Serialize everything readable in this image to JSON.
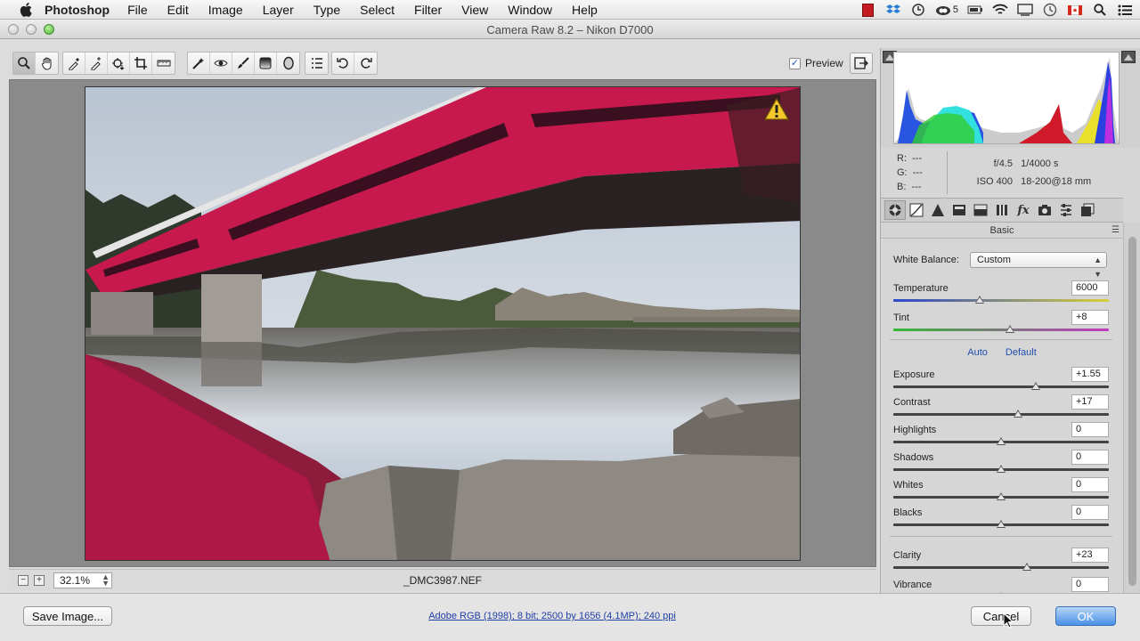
{
  "menubar": {
    "app_name": "Photoshop",
    "items": [
      "File",
      "Edit",
      "Image",
      "Layer",
      "Type",
      "Select",
      "Filter",
      "View",
      "Window",
      "Help"
    ],
    "status_badge": "5"
  },
  "window": {
    "title": "Camera Raw 8.2  –  Nikon D7000"
  },
  "toolbar": {
    "tools": [
      "zoom-tool",
      "hand-tool",
      "white-balance-tool",
      "color-sampler-tool",
      "targeted-adjustment-tool",
      "crop-tool",
      "straighten-tool",
      "spot-removal-tool",
      "red-eye-removal-tool",
      "adjustment-brush-tool",
      "graduated-filter-tool",
      "radial-filter-tool",
      "preferences",
      "rotate-left",
      "rotate-right"
    ],
    "preview_label": "Preview",
    "preview_checked": true
  },
  "canvas": {
    "zoom_value": "32.1%",
    "filename": "_DMC3987.NEF"
  },
  "info": {
    "r_label": "R:",
    "r_value": "---",
    "g_label": "G:",
    "g_value": "---",
    "b_label": "B:",
    "b_value": "---",
    "aperture": "f/4.5",
    "shutter": "1/4000 s",
    "iso": "ISO 400",
    "lens": "18-200@18 mm"
  },
  "panel": {
    "title": "Basic",
    "white_balance_label": "White Balance:",
    "white_balance_value": "Custom",
    "auto_label": "Auto",
    "default_label": "Default",
    "sliders": [
      {
        "label": "Temperature",
        "value": "6000",
        "level": 0.4
      },
      {
        "label": "Tint",
        "value": "+8",
        "level": 0.54
      },
      {
        "label": "Exposure",
        "value": "+1.55",
        "level": 0.66
      },
      {
        "label": "Contrast",
        "value": "+17",
        "level": 0.58
      },
      {
        "label": "Highlights",
        "value": "0",
        "level": 0.5
      },
      {
        "label": "Shadows",
        "value": "0",
        "level": 0.5
      },
      {
        "label": "Whites",
        "value": "0",
        "level": 0.5
      },
      {
        "label": "Blacks",
        "value": "0",
        "level": 0.5
      },
      {
        "label": "Clarity",
        "value": "+23",
        "level": 0.62
      },
      {
        "label": "Vibrance",
        "value": "0",
        "level": 0.5
      }
    ]
  },
  "bottom": {
    "save_label": "Save Image...",
    "workflow_link": "Adobe RGB (1998); 8 bit; 2500 by 1656 (4.1MP); 240 ppi",
    "cancel_label": "Cancel",
    "ok_label": "OK"
  },
  "colors": {
    "accent": "#4a90e6",
    "bridge": "#c8194e",
    "link": "#1f3fa6"
  }
}
